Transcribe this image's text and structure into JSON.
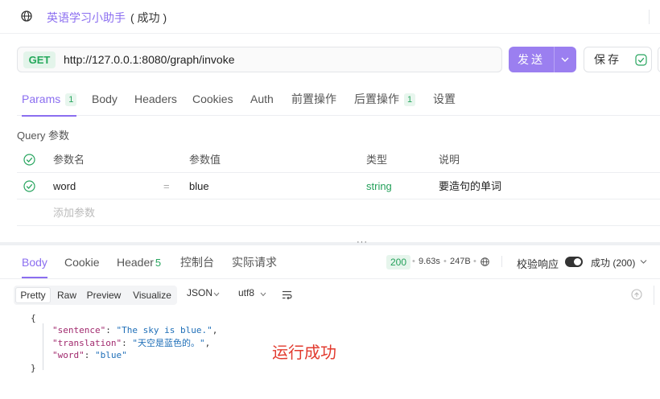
{
  "title_bar": {
    "name": "英语学习小助手",
    "status": "( 成功 )"
  },
  "request": {
    "method": "GET",
    "url": "http://127.0.0.1:8080/graph/invoke",
    "send_label": "发送",
    "save_label": "保存"
  },
  "tabs": [
    {
      "label": "Params",
      "count": "1",
      "active": true
    },
    {
      "label": "Body"
    },
    {
      "label": "Headers"
    },
    {
      "label": "Cookies"
    },
    {
      "label": "Auth"
    },
    {
      "label": "前置操作"
    },
    {
      "label": "后置操作",
      "count": "1"
    },
    {
      "label": "设置"
    }
  ],
  "query": {
    "section_title": "Query 参数",
    "columns": [
      "参数名",
      "参数值",
      "类型",
      "说明"
    ],
    "rows": [
      {
        "name": "word",
        "eq": "=",
        "value": "blue",
        "type": "string",
        "description": "要造句的单词"
      }
    ],
    "add_placeholder": "添加参数"
  },
  "response": {
    "tabs": [
      {
        "label": "Body",
        "active": true
      },
      {
        "label": "Cookie"
      },
      {
        "label": "Header",
        "count": "5"
      },
      {
        "label": "控制台"
      },
      {
        "label": "实际请求"
      }
    ],
    "status_code": "200",
    "time": "9.63s",
    "size": "247B",
    "validate_label": "校验响应",
    "result_status": "成功 (200)",
    "views": [
      "Pretty",
      "Raw",
      "Preview",
      "Visualize"
    ],
    "active_view": "Pretty",
    "format": "JSON",
    "encoding": "utf8",
    "body_lines": {
      "open": "{",
      "sentence_key": "\"sentence\"",
      "sentence_value": "\"The sky is blue.\"",
      "translation_key": "\"translation\"",
      "translation_value": "\"天空是蓝色的。\"",
      "word_key": "\"word\"",
      "word_value": "\"blue\"",
      "close": "}"
    }
  },
  "annotation": "运行成功",
  "colors": {
    "accent": "#8b6ef0",
    "send_button": "#9b7ff0",
    "success": "#23a05a",
    "annotation": "#e23a2e"
  },
  "icons": {
    "title": "globe-icon",
    "send_dropdown": "chevron-down-icon",
    "save_status": "check-circle-icon",
    "param_enabled": "check-circle-icon",
    "meta": "globe-icon",
    "wrap": "wrap-lines-icon",
    "scroll_top": "arrow-up-circle-icon"
  }
}
